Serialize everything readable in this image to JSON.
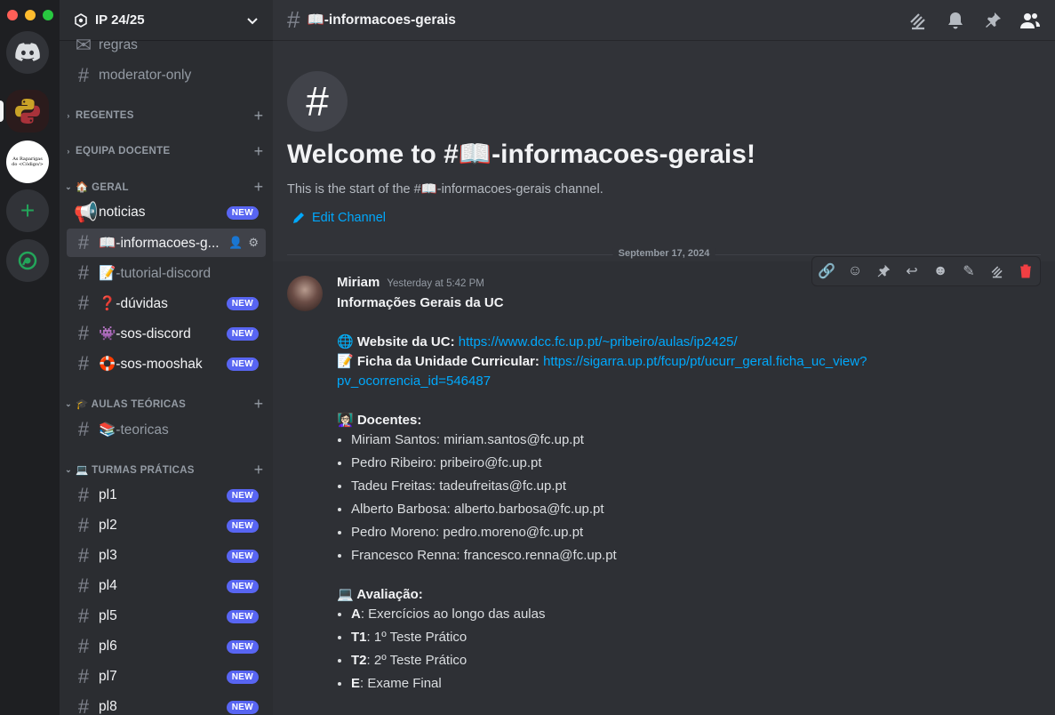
{
  "window": {
    "traffic_colors": [
      "#ff5f57",
      "#febc2e",
      "#28c840"
    ]
  },
  "servers": [
    {
      "name": "Direct Messages"
    },
    {
      "name": "Python"
    },
    {
      "name": "As Raparigas do Código",
      "logo_text": "As Raparigas do <Código/>"
    },
    {
      "name": "Add a Server"
    },
    {
      "name": "Explore"
    }
  ],
  "guild": {
    "name": "IP 24/25"
  },
  "channels": {
    "regras": "regras",
    "moderator_only": "moderator-only",
    "noticias": "noticias",
    "informacoes": "📖-informacoes-g...",
    "tutorial": "📝-tutorial-discord",
    "duvidas": "❓-dúvidas",
    "sos_discord": "👾-sos-discord",
    "sos_mooshak": "🛟-sos-mooshak",
    "teoricas": "📚-teoricas",
    "pl1": "pl1",
    "pl2": "pl2",
    "pl3": "pl3",
    "pl4": "pl4",
    "pl5": "pl5",
    "pl6": "pl6",
    "pl7": "pl7",
    "pl8": "pl8"
  },
  "categories": {
    "regentes": "REGENTES",
    "equipa": "EQUIPA DOCENTE",
    "geral": "🏠 GERAL",
    "aulas": "🎓 AULAS TEÓRICAS",
    "turmas": "💻 TURMAS PRÁTICAS"
  },
  "badge": {
    "new": "NEW"
  },
  "topbar": {
    "channel_name": "📖-informacoes-gerais"
  },
  "welcome": {
    "title": "Welcome to #📖-informacoes-gerais!",
    "subtitle": "This is the start of the #📖-informacoes-gerais channel.",
    "edit_label": "Edit Channel"
  },
  "divider": {
    "date": "September 17, 2024"
  },
  "message": {
    "author": "Miriam",
    "timestamp": "Yesterday at 5:42 PM",
    "heading": "Informações Gerais da UC",
    "website_label": "🌐 Website da UC:",
    "website_url": "https://www.dcc.fc.up.pt/~pribeiro/aulas/ip2425/",
    "ficha_label": "📝 Ficha da Unidade Curricular:",
    "ficha_url_1": "https://sigarra.up.pt/fcup/pt/ucurr_geral.ficha_uc_view?",
    "ficha_url_2": "pv_ocorrencia_id=546487",
    "docentes_label": "👩🏻‍🏫 Docentes:",
    "docentes": [
      "Miriam Santos: miriam.santos@fc.up.pt",
      "Pedro Ribeiro: pribeiro@fc.up.pt",
      "Tadeu Freitas: tadeufreitas@fc.up.pt",
      "Alberto Barbosa: alberto.barbosa@fc.up.pt",
      "Pedro Moreno: pedro.moreno@fc.up.pt",
      "Francesco Renna: francesco.renna@fc.up.pt"
    ],
    "avaliacao_label": "💻 Avaliação:",
    "avaliacao": [
      {
        "key": "A",
        "text": ": Exercícios ao longo das aulas"
      },
      {
        "key": "T1",
        "text": ": 1º Teste Prático"
      },
      {
        "key": "T2",
        "text": ": 2º Teste Prático"
      },
      {
        "key": "E",
        "text": ": Exame Final"
      }
    ]
  },
  "colors": {
    "accent": "#5865f2",
    "link": "#00a8fc",
    "delete": "#f23f43",
    "online_green": "#23a55a"
  }
}
